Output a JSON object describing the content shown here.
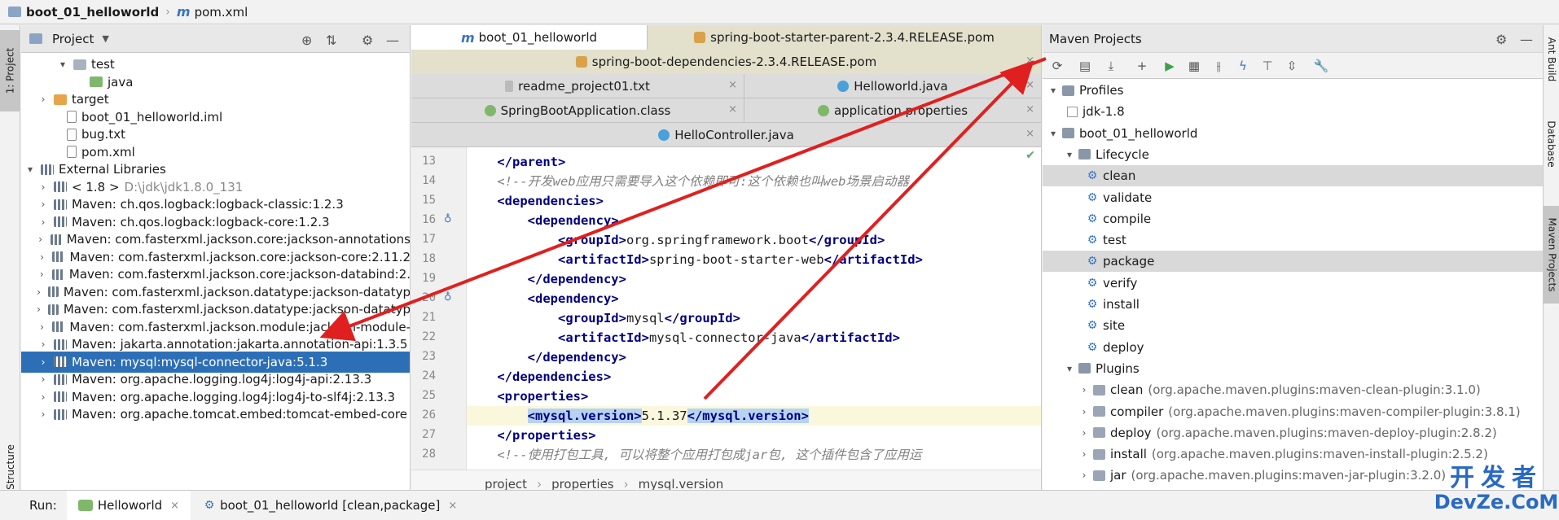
{
  "breadcrumb": {
    "project": "boot_01_helloworld",
    "file": "pom.xml"
  },
  "left_strip": {
    "project_tab": "1: Project",
    "structure_tab": "Structure"
  },
  "project_panel": {
    "title": "Project",
    "tree": [
      {
        "label": "test",
        "detail": ""
      },
      {
        "label": "java",
        "detail": ""
      },
      {
        "label": "target",
        "detail": ""
      },
      {
        "label": "boot_01_helloworld.iml",
        "detail": ""
      },
      {
        "label": "bug.txt",
        "detail": ""
      },
      {
        "label": "pom.xml",
        "detail": ""
      },
      {
        "label": "External Libraries",
        "detail": ""
      },
      {
        "label": "< 1.8 >",
        "detail": "D:\\jdk\\jdk1.8.0_131"
      },
      {
        "label": "Maven: ch.qos.logback:logback-classic:1.2.3",
        "detail": ""
      },
      {
        "label": "Maven: ch.qos.logback:logback-core:1.2.3",
        "detail": ""
      },
      {
        "label": "Maven: com.fasterxml.jackson.core:jackson-annotations",
        "detail": ""
      },
      {
        "label": "Maven: com.fasterxml.jackson.core:jackson-core:2.11.2",
        "detail": ""
      },
      {
        "label": "Maven: com.fasterxml.jackson.core:jackson-databind:2.",
        "detail": ""
      },
      {
        "label": "Maven: com.fasterxml.jackson.datatype:jackson-datatyp",
        "detail": ""
      },
      {
        "label": "Maven: com.fasterxml.jackson.datatype:jackson-datatyp",
        "detail": ""
      },
      {
        "label": "Maven: com.fasterxml.jackson.module:jackson-module-",
        "detail": ""
      },
      {
        "label": "Maven: jakarta.annotation:jakarta.annotation-api:1.3.5",
        "detail": ""
      },
      {
        "label": "Maven: mysql:mysql-connector-java:5.1.3",
        "detail": ""
      },
      {
        "label": "Maven: org.apache.logging.log4j:log4j-api:2.13.3",
        "detail": ""
      },
      {
        "label": "Maven: org.apache.logging.log4j:log4j-to-slf4j:2.13.3",
        "detail": ""
      },
      {
        "label": "Maven: org.apache.tomcat.embed:tomcat-embed-core",
        "detail": ""
      }
    ]
  },
  "editor": {
    "tabs_row1": [
      "boot_01_helloworld",
      "spring-boot-starter-parent-2.3.4.RELEASE.pom"
    ],
    "tabs_row2": [
      "spring-boot-dependencies-2.3.4.RELEASE.pom"
    ],
    "tabs_row3": [
      "readme_project01.txt",
      "Helloworld.java"
    ],
    "tabs_row4": [
      "SpringBootApplication.class",
      "application.properties"
    ],
    "tabs_row5": [
      "HelloController.java"
    ],
    "close_glyph": "×",
    "lines": [
      {
        "n": "13",
        "t": "    </parent>"
      },
      {
        "n": "14",
        "t": "    <!--开发web应用只需要导入这个依赖即可:这个依赖也叫web场景启动器"
      },
      {
        "n": "15",
        "t": "    <dependencies>"
      },
      {
        "n": "16",
        "t": "        <dependency>"
      },
      {
        "n": "17",
        "t": "            <groupId>org.springframework.boot</groupId>"
      },
      {
        "n": "18",
        "t": "            <artifactId>spring-boot-starter-web</artifactId>"
      },
      {
        "n": "19",
        "t": "        </dependency>"
      },
      {
        "n": "20",
        "t": "        <dependency>"
      },
      {
        "n": "21",
        "t": "            <groupId>mysql</groupId>"
      },
      {
        "n": "22",
        "t": "            <artifactId>mysql-connector-java</artifactId>"
      },
      {
        "n": "23",
        "t": "        </dependency>"
      },
      {
        "n": "24",
        "t": "    </dependencies>"
      },
      {
        "n": "25",
        "t": "    <properties>"
      },
      {
        "n": "26",
        "t": "        <mysql.version>5.1.37</mysql.version>"
      },
      {
        "n": "27",
        "t": "    </properties>"
      },
      {
        "n": "28",
        "t": "    <!--使用打包工具, 可以将整个应用打包成jar包, 这个插件包含了应用运"
      }
    ],
    "breadcrumbs": [
      "project",
      "properties",
      "mysql.version"
    ]
  },
  "maven": {
    "title": "Maven Projects",
    "rows": [
      {
        "label": "Profiles",
        "detail": ""
      },
      {
        "label": "jdk-1.8",
        "detail": ""
      },
      {
        "label": "boot_01_helloworld",
        "detail": ""
      },
      {
        "label": "Lifecycle",
        "detail": ""
      },
      {
        "label": "clean",
        "detail": ""
      },
      {
        "label": "validate",
        "detail": ""
      },
      {
        "label": "compile",
        "detail": ""
      },
      {
        "label": "test",
        "detail": ""
      },
      {
        "label": "package",
        "detail": ""
      },
      {
        "label": "verify",
        "detail": ""
      },
      {
        "label": "install",
        "detail": ""
      },
      {
        "label": "site",
        "detail": ""
      },
      {
        "label": "deploy",
        "detail": ""
      },
      {
        "label": "Plugins",
        "detail": ""
      },
      {
        "label": "clean",
        "detail": "(org.apache.maven.plugins:maven-clean-plugin:3.1.0)"
      },
      {
        "label": "compiler",
        "detail": "(org.apache.maven.plugins:maven-compiler-plugin:3.8.1)"
      },
      {
        "label": "deploy",
        "detail": "(org.apache.maven.plugins:maven-deploy-plugin:2.8.2)"
      },
      {
        "label": "install",
        "detail": "(org.apache.maven.plugins:maven-install-plugin:2.5.2)"
      },
      {
        "label": "jar",
        "detail": "(org.apache.maven.plugins:maven-jar-plugin:3.2.0)"
      }
    ]
  },
  "right_strip": {
    "ant": "Ant Build",
    "database": "Database",
    "maven": "Maven Projects"
  },
  "runbar": {
    "label": "Run:",
    "tabs": [
      {
        "label": "Helloworld"
      },
      {
        "label": "boot_01_helloworld [clean,package]"
      }
    ]
  },
  "watermark": {
    "line1": "开发者",
    "line2": "DevZe.CoM"
  },
  "colors": {
    "selection": "#2d6fb7",
    "arrow": "#e02020",
    "tag": "#000080"
  }
}
